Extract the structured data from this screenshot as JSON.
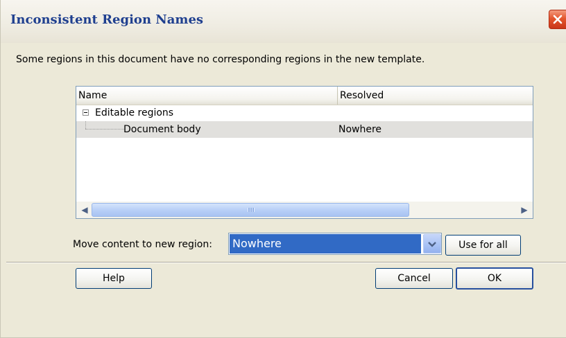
{
  "window": {
    "title": "Inconsistent Region Names"
  },
  "message": "Some regions in this document have no corresponding regions in the new template.",
  "list": {
    "columns": [
      "Name",
      "Resolved"
    ],
    "group": {
      "label": "Editable regions",
      "expanded": true
    },
    "rows": [
      {
        "name": "Document body",
        "resolved": "Nowhere",
        "selected": true
      }
    ]
  },
  "move": {
    "label": "Move content to new region:",
    "selected": "Nowhere"
  },
  "buttons": {
    "use_for_all": "Use for all",
    "help": "Help",
    "cancel": "Cancel",
    "ok": "OK"
  },
  "icons": {
    "close": "close-icon",
    "collapse": "collapse-icon",
    "dropdown": "chevron-down-icon",
    "scroll_left": "scroll-left-icon",
    "scroll_right": "scroll-right-icon"
  },
  "colors": {
    "title_text": "#1F3F8F",
    "selection": "#316AC5",
    "close_button": "#E4562E",
    "dialog_bg": "#ECE9D8"
  }
}
